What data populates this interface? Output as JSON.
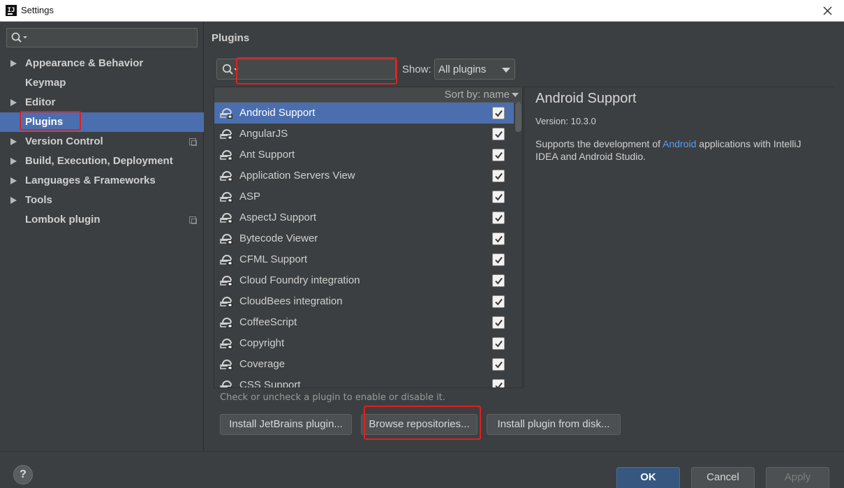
{
  "window": {
    "title": "Settings",
    "icon_letter": "IJ"
  },
  "sidebar": {
    "search_placeholder": "",
    "items": [
      {
        "label": "Appearance & Behavior",
        "expandable": true
      },
      {
        "label": "Keymap",
        "expandable": false
      },
      {
        "label": "Editor",
        "expandable": true
      },
      {
        "label": "Plugins",
        "expandable": false,
        "selected": true
      },
      {
        "label": "Version Control",
        "expandable": true,
        "project_icon": true
      },
      {
        "label": "Build, Execution, Deployment",
        "expandable": true
      },
      {
        "label": "Languages & Frameworks",
        "expandable": true
      },
      {
        "label": "Tools",
        "expandable": true
      },
      {
        "label": "Lombok plugin",
        "expandable": false,
        "project_icon": true
      }
    ],
    "help_label": "?"
  },
  "main": {
    "title": "Plugins",
    "search_value": "",
    "show_label": "Show:",
    "show_value": "All plugins",
    "sort_label": "Sort by: name",
    "plugins": [
      {
        "name": "Android Support",
        "checked": true,
        "selected": true
      },
      {
        "name": "AngularJS",
        "checked": true
      },
      {
        "name": "Ant Support",
        "checked": true
      },
      {
        "name": "Application Servers View",
        "checked": true
      },
      {
        "name": "ASP",
        "checked": true
      },
      {
        "name": "AspectJ Support",
        "checked": true
      },
      {
        "name": "Bytecode Viewer",
        "checked": true
      },
      {
        "name": "CFML Support",
        "checked": true
      },
      {
        "name": "Cloud Foundry integration",
        "checked": true
      },
      {
        "name": "CloudBees integration",
        "checked": true
      },
      {
        "name": "CoffeeScript",
        "checked": true
      },
      {
        "name": "Copyright",
        "checked": true
      },
      {
        "name": "Coverage",
        "checked": true
      },
      {
        "name": "CSS Support",
        "checked": true
      }
    ],
    "detail": {
      "title": "Android Support",
      "version": "Version: 10.3.0",
      "desc_before": "Supports the development of ",
      "desc_link": "Android",
      "desc_after": " applications with IntelliJ IDEA and Android Studio."
    },
    "hint": "Check or uncheck a plugin to enable or disable it.",
    "buttons": {
      "install_jetbrains": "Install JetBrains plugin...",
      "browse": "Browse repositories...",
      "install_disk": "Install plugin from disk..."
    }
  },
  "footer": {
    "ok": "OK",
    "cancel": "Cancel",
    "apply": "Apply"
  },
  "colors": {
    "background": "#3c3f41",
    "selection": "#4b6eaf",
    "link": "#589df6",
    "highlight": "#e0201f"
  }
}
